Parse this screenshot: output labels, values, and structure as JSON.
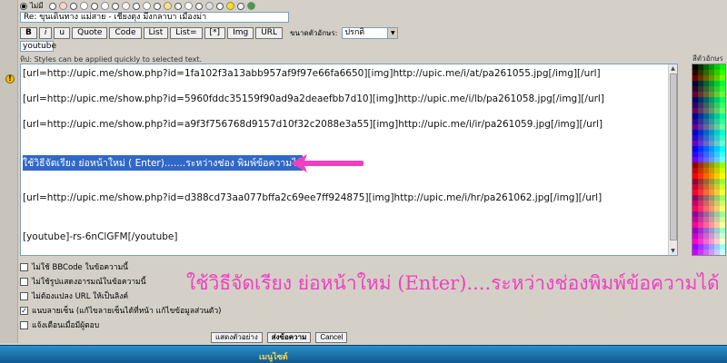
{
  "mode_options": {
    "selected_label": "ไม่มี"
  },
  "subject": {
    "value": "Re: ขุนเดินทาง แม่สาย - เชียงตุง มึงกลาบา เมืองม่า"
  },
  "toolbar": {
    "buttons": [
      "B",
      "i",
      "u",
      "Quote",
      "Code",
      "List",
      "List=",
      "[*]",
      "Img",
      "URL"
    ],
    "size_label": "ขนาดตัวอักษร:",
    "size_value": "ปรกติ"
  },
  "tag_box": {
    "value": "youtube"
  },
  "tip": "ทิป: Styles can be applied quickly to selected text.",
  "palette": {
    "label": "สีตัวอักษร",
    "colors": [
      "#000000",
      "#003300",
      "#006600",
      "#009900",
      "#00cc00",
      "#00ff00",
      "#330000",
      "#333300",
      "#336600",
      "#339900",
      "#33cc00",
      "#33ff00",
      "#660000",
      "#663300",
      "#666600",
      "#669900",
      "#66cc00",
      "#66ff00",
      "#000033",
      "#003333",
      "#006633",
      "#009933",
      "#00cc33",
      "#00ff33",
      "#330033",
      "#333333",
      "#336633",
      "#339933",
      "#33cc33",
      "#33ff33",
      "#660033",
      "#663333",
      "#666633",
      "#669933",
      "#66cc33",
      "#66ff33",
      "#000066",
      "#003366",
      "#006666",
      "#009966",
      "#00cc66",
      "#00ff66",
      "#330066",
      "#333366",
      "#336666",
      "#339966",
      "#33cc66",
      "#33ff66",
      "#660066",
      "#663366",
      "#666666",
      "#669966",
      "#66cc66",
      "#66ff66",
      "#000099",
      "#003399",
      "#006699",
      "#009999",
      "#00cc99",
      "#00ff99",
      "#330099",
      "#333399",
      "#336699",
      "#339999",
      "#33cc99",
      "#33ff99",
      "#660099",
      "#663399",
      "#666699",
      "#669999",
      "#66cc99",
      "#66ff99",
      "#0000cc",
      "#0033cc",
      "#0066cc",
      "#0099cc",
      "#00cccc",
      "#00ffcc",
      "#3300cc",
      "#3333cc",
      "#3366cc",
      "#3399cc",
      "#33cccc",
      "#33ffcc",
      "#6600cc",
      "#6633cc",
      "#6666cc",
      "#6699cc",
      "#66cccc",
      "#66ffcc",
      "#0000ff",
      "#0033ff",
      "#0066ff",
      "#0099ff",
      "#00ccff",
      "#00ffff",
      "#3300ff",
      "#3333ff",
      "#3366ff",
      "#3399ff",
      "#33ccff",
      "#33ffff",
      "#6600ff",
      "#6633ff",
      "#6666ff",
      "#6699ff",
      "#66ccff",
      "#66ffff",
      "#990000",
      "#993300",
      "#996600",
      "#999900",
      "#99cc00",
      "#99ff00",
      "#cc0000",
      "#cc3300",
      "#cc6600",
      "#cc9900",
      "#cccc00",
      "#ccff00",
      "#ff0000",
      "#ff3300",
      "#ff6600",
      "#ff9900",
      "#ffcc00",
      "#ffff00",
      "#990033",
      "#993333",
      "#996633",
      "#999933",
      "#99cc33",
      "#99ff33",
      "#cc0033",
      "#cc3333",
      "#cc6633",
      "#cc9933",
      "#cccc33",
      "#ccff33",
      "#ff0033",
      "#ff3333",
      "#ff6633",
      "#ff9933",
      "#ffcc33",
      "#ffff33",
      "#990066",
      "#993366",
      "#996666",
      "#999966",
      "#99cc66",
      "#99ff66",
      "#cc0066",
      "#cc3366",
      "#cc6666",
      "#cc9966",
      "#cccc66",
      "#ccff66",
      "#ff0066",
      "#ff3366",
      "#ff6666",
      "#ff9966",
      "#ffcc66",
      "#ffff66",
      "#990099",
      "#993399",
      "#996699",
      "#999999",
      "#99cc99",
      "#99ff99",
      "#cc0099",
      "#cc3399",
      "#cc6699",
      "#cc9999",
      "#cccc99",
      "#ccff99",
      "#ff0099",
      "#ff3399",
      "#ff6699",
      "#ff9999",
      "#ffcc99",
      "#ffff99",
      "#9900cc",
      "#9933cc",
      "#9966cc",
      "#9999cc",
      "#99cccc",
      "#99ffcc",
      "#cc00cc",
      "#cc33cc",
      "#cc66cc",
      "#cc99cc",
      "#cccccc",
      "#ccffcc",
      "#ff00cc",
      "#ff33cc",
      "#ff66cc",
      "#ff99cc",
      "#ffcccc",
      "#ffffcc",
      "#9900ff",
      "#9933ff",
      "#9966ff",
      "#9999ff",
      "#99ccff",
      "#99ffff",
      "#cc00ff",
      "#cc33ff",
      "#cc66ff",
      "#cc99ff",
      "#ccccff",
      "#ccffff",
      "#ff00ff",
      "#ff33ff",
      "#ff66ff",
      "#ff99ff",
      "#ffccff",
      "#ffffff"
    ]
  },
  "editor": {
    "lines": [
      "[url=http://upic.me/show.php?id=1fa102f3a13abb957af9f97e66fa6650][img]http://upic.me/i/at/pa261055.jpg[/img][/url]",
      "[url=http://upic.me/show.php?id=5960fddc35159f90ad9a2deaefbb7d10][img]http://upic.me/i/lb/pa261058.jpg[/img][/url]",
      "[url=http://upic.me/show.php?id=a9f3f756768d9157d10f32c2088e3a55][img]http://upic.me/i/ir/pa261059.jpg[/img][/url]",
      "ใช้วิธีจัดเรียง ย่อหน้าใหม่ ( Enter).......ระหว่างช่อง พิมพ์ข้อความได้",
      "[url=http://upic.me/show.php?id=d388cd73aa077bffa2c69ee7ff924875][img]http://upic.me/i/hr/pa261062.jpg[/img][/url]",
      "[youtube]-rs-6nClGFM[/youtube]"
    ]
  },
  "options": [
    {
      "label": "ไม่ใช้ BBCode ในข้อความนี้",
      "checked": false
    },
    {
      "label": "ไม่ใช้รูปแสดงอารมณ์ในข้อความนี้",
      "checked": false
    },
    {
      "label": "ไม่ต้องแปลง URL ให้เป็นลิงค์",
      "checked": false
    },
    {
      "label": "แนบลายเซ็น (แก้ไขลายเซ็นได้ที่หน้า แก้ไขข้อมูลส่วนตัว)",
      "checked": true
    },
    {
      "label": "แจ้งเตือนเมื่อมีผู้ตอบ",
      "checked": false
    }
  ],
  "annotation": "ใช้วิธีจัดเรียง ย่อหน้าใหม่ (Enter)....ระหว่างช่องพิมพ์ข้อความได้",
  "actions": {
    "preview": "แสดงตัวอย่าง",
    "submit": "ส่งข้อความ",
    "cancel": "Cancel"
  },
  "footer": {
    "menu": "เมนูไซต์"
  },
  "colors": {
    "annotation": "#f040c0",
    "selection": "#3168c8",
    "footer": "#1b74ad"
  }
}
